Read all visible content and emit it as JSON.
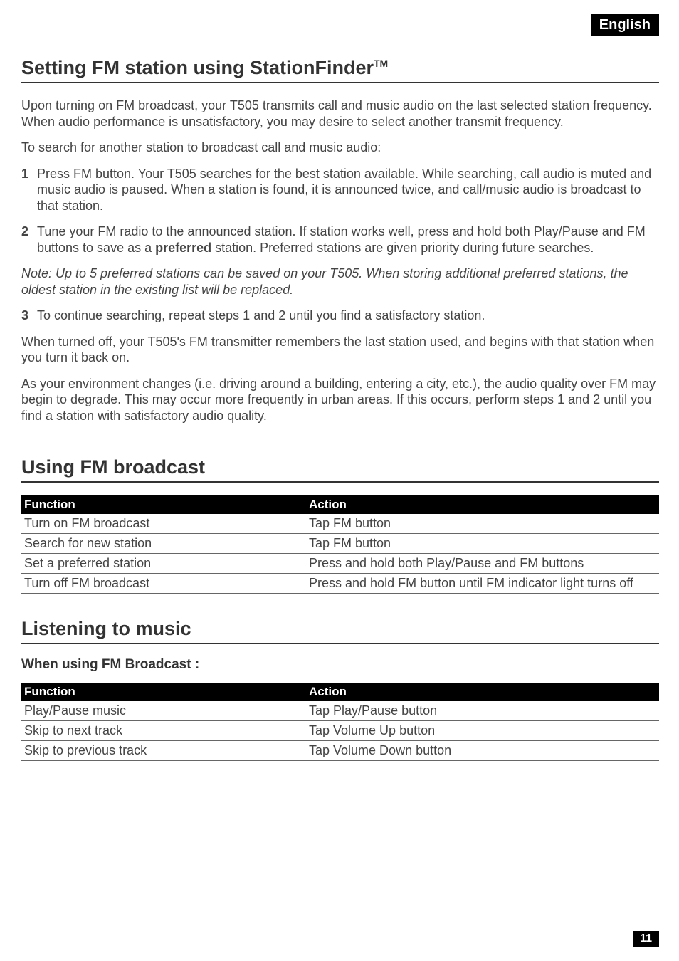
{
  "lang_tag": "English",
  "section1": {
    "title": "Setting FM station using StationFinder",
    "tm": "TM",
    "p1": "Upon turning on FM broadcast, your T505 transmits call and music audio on the last selected station frequency. When audio performance is unsatisfactory, you may desire to select another transmit frequency.",
    "p2": "To search for another station to broadcast call and music audio:",
    "steps": [
      {
        "num": "1",
        "text": "Press FM button. Your T505 searches for the best station available. While searching, call audio is muted and music audio is paused. When a station is found, it is announced twice, and call/music audio is broadcast to that station."
      },
      {
        "num": "2",
        "text_before": "Tune your FM radio to the announced station. If station works well, press and hold both Play/Pause and FM buttons to save as a ",
        "bold": "preferred",
        "text_after": " station. Preferred stations are given priority during future searches."
      }
    ],
    "note": "Note: Up to 5 preferred stations can be saved on your T505. When storing additional preferred stations, the oldest station in the existing list will be replaced.",
    "step3": {
      "num": "3",
      "text": "To continue searching, repeat steps 1 and 2 until you find a satisfactory station."
    },
    "p3": "When turned off, your T505's FM transmitter remembers the last station used, and begins with that station when you turn it back on.",
    "p4": "As your environment changes (i.e. driving around a building, entering a city, etc.), the audio quality over FM may begin to degrade. This may occur more frequently in urban areas. If this occurs, perform steps 1 and 2 until you find a station with satisfactory audio quality."
  },
  "section2": {
    "title": "Using FM broadcast",
    "headers": {
      "c1": "Function",
      "c2": "Action"
    },
    "rows": [
      {
        "func": "Turn on FM broadcast",
        "action": "Tap FM button"
      },
      {
        "func": "Search for new station",
        "action": "Tap FM button"
      },
      {
        "func": "Set a preferred station",
        "action": "Press and hold both Play/Pause and FM buttons"
      },
      {
        "func": "Turn off FM broadcast",
        "action": "Press and hold FM button until FM indicator light turns off"
      }
    ]
  },
  "section3": {
    "title": "Listening to music",
    "subtitle": "When using FM Broadcast :",
    "headers": {
      "c1": "Function",
      "c2": "Action"
    },
    "rows": [
      {
        "func": "Play/Pause music",
        "action": "Tap Play/Pause button"
      },
      {
        "func": "Skip to next track",
        "action": "Tap Volume Up button"
      },
      {
        "func": "Skip to previous track",
        "action": "Tap Volume Down button"
      }
    ]
  },
  "page_num": "11"
}
